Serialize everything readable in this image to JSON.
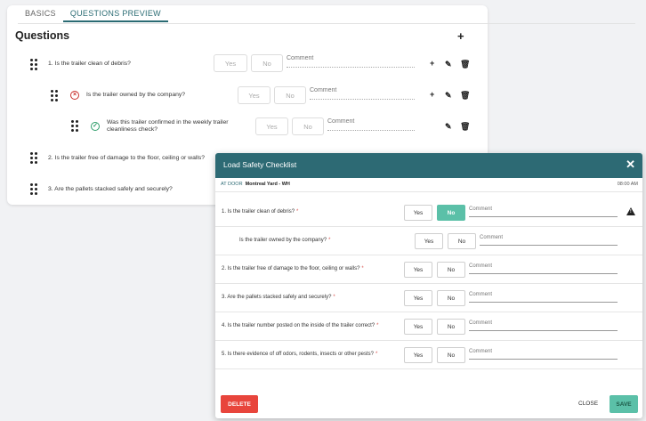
{
  "tabs": [
    {
      "label": "BASICS"
    },
    {
      "label": "QUESTIONS PREVIEW"
    }
  ],
  "questions": {
    "title": "Questions",
    "add_icon": "plus-icon",
    "rows": [
      {
        "label": "1.  Is the trailer clean of debris?",
        "yes": "Yes",
        "no": "No",
        "comment": "Comment"
      },
      {
        "label": "Is the trailer owned by the company?",
        "yes": "Yes",
        "no": "No",
        "comment": "Comment"
      },
      {
        "label": "Was this trailer confirmed in the weekly trailer cleanliness check?",
        "yes": "Yes",
        "no": "No",
        "comment": "Comment"
      },
      {
        "label": "2.  Is the trailer free of damage to the floor, ceiling or walls?"
      },
      {
        "label": "3.  Are the pallets stacked safely and securely?"
      }
    ]
  },
  "modal": {
    "title": "Load Safety Checklist",
    "close_icon": "close-icon",
    "location_label": "AT DOOR",
    "site": "Montreal Yard - WH",
    "time": "08:00 AM",
    "rows": [
      {
        "question": "1. Is the trailer clean of debris?",
        "required": "*",
        "yes": "Yes",
        "no": "No",
        "comment": "Comment",
        "selected": "No",
        "warning": "!"
      },
      {
        "question": "Is the trailer owned by the company?",
        "required": "*",
        "yes": "Yes",
        "no": "No",
        "comment": "Comment"
      },
      {
        "question": "2. Is the trailer free of damage to the floor, ceiling or walls?",
        "required": "*",
        "yes": "Yes",
        "no": "No",
        "comment": "Comment"
      },
      {
        "question": "3. Are the pallets stacked safely and securely?",
        "required": "*",
        "yes": "Yes",
        "no": "No",
        "comment": "Comment"
      },
      {
        "question": "4. Is the trailer number posted on the inside of the trailer correct?",
        "required": "*",
        "yes": "Yes",
        "no": "No",
        "comment": "Comment"
      },
      {
        "question": "5. Is there evidence of off odors, rodents, insects or other pests?",
        "required": "*",
        "yes": "Yes",
        "no": "No",
        "comment": "Comment"
      }
    ],
    "footer": {
      "delete": "DELETE",
      "close": "CLOSE",
      "save": "SAVE"
    }
  },
  "colors": {
    "header": "#2d6a74",
    "selected": "#5bc0a8",
    "delete": "#e8453c",
    "required": "#d9534f"
  }
}
